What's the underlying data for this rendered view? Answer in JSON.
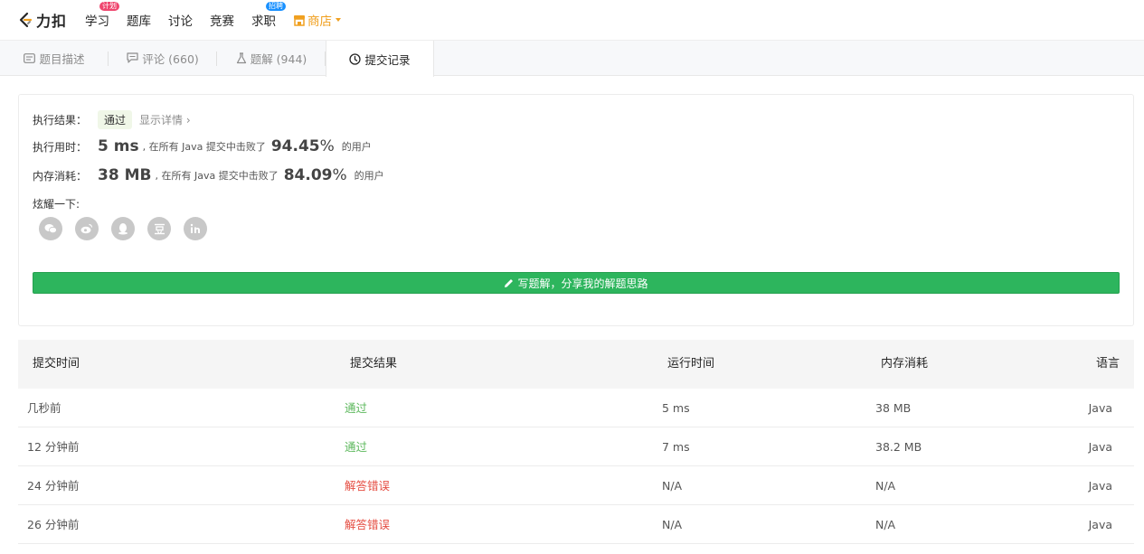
{
  "nav": {
    "brand": "力扣",
    "items": [
      {
        "label": "学习",
        "badge": "计划",
        "badge_color": "pink"
      },
      {
        "label": "题库"
      },
      {
        "label": "讨论"
      },
      {
        "label": "竞赛"
      },
      {
        "label": "求职",
        "badge": "招聘",
        "badge_color": "blue"
      }
    ],
    "shop": "商店"
  },
  "tabs": [
    {
      "label": "题目描述",
      "icon": "description-icon"
    },
    {
      "label": "评论 (660)",
      "icon": "comment-icon"
    },
    {
      "label": "题解 (944)",
      "icon": "flask-icon"
    },
    {
      "label": "提交记录",
      "icon": "clock-icon",
      "active": true
    }
  ],
  "result": {
    "result_label": "执行结果：",
    "result_value": "通过",
    "detail_link": "显示详情 ›",
    "time_label": "执行用时：",
    "time_value": "5 ms",
    "time_beat_text": ", 在所有 Java 提交中击败了",
    "time_pct": "94.45",
    "time_users": "的用户",
    "mem_label": "内存消耗：",
    "mem_value": "38 MB",
    "mem_beat_text": ", 在所有 Java 提交中击败了",
    "mem_pct": "84.09",
    "mem_users": "的用户",
    "pct_unit": "%",
    "share_label": "炫耀一下:",
    "share_icons": [
      "wechat-icon",
      "weibo-icon",
      "qq-icon",
      "douban-icon",
      "linkedin-icon"
    ],
    "write_button": "写题解，分享我的解题思路"
  },
  "table": {
    "headers": [
      "提交时间",
      "提交结果",
      "运行时间",
      "内存消耗",
      "语言"
    ],
    "rows": [
      {
        "time": "几秒前",
        "result": "通过",
        "status": "ok",
        "runtime": "5 ms",
        "memory": "38 MB",
        "lang": "Java"
      },
      {
        "time": "12 分钟前",
        "result": "通过",
        "status": "ok",
        "runtime": "7 ms",
        "memory": "38.2 MB",
        "lang": "Java"
      },
      {
        "time": "24 分钟前",
        "result": "解答错误",
        "status": "err",
        "runtime": "N/A",
        "memory": "N/A",
        "lang": "Java"
      },
      {
        "time": "26 分钟前",
        "result": "解答错误",
        "status": "err",
        "runtime": "N/A",
        "memory": "N/A",
        "lang": "Java"
      }
    ]
  }
}
